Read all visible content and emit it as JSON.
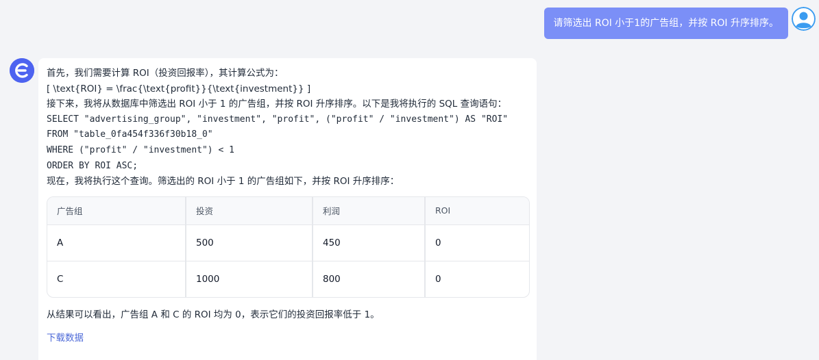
{
  "user_message": {
    "text": "请筛选出 ROI 小于1的广告组，并按 ROI 升序排序。"
  },
  "assistant": {
    "lines": [
      {
        "text": "首先，我们需要计算 ROI（投资回报率），其计算公式为：",
        "code": false
      },
      {
        "text": "[ \\text{ROI} = \\frac{\\text{profit}}{\\text{investment}} ]",
        "code": false
      },
      {
        "text": "接下来，我将从数据库中筛选出 ROI 小于 1 的广告组，并按 ROI 升序排序。以下是我将执行的 SQL 查询语句：",
        "code": false
      },
      {
        "text": "SELECT \"advertising_group\", \"investment\", \"profit\", (\"profit\" / \"investment\") AS \"ROI\"",
        "code": true
      },
      {
        "text": "FROM \"table_0fa454f336f30b18_0\"",
        "code": true
      },
      {
        "text": "WHERE (\"profit\" / \"investment\") < 1",
        "code": true
      },
      {
        "text": "ORDER BY ROI ASC;",
        "code": true
      },
      {
        "text": "现在，我将执行这个查询。筛选出的 ROI 小于 1 的广告组如下，并按 ROI 升序排序：",
        "code": false
      }
    ],
    "table": {
      "headers": [
        "广告组",
        "投资",
        "利润",
        "ROI"
      ],
      "rows": [
        [
          "A",
          "500",
          "450",
          "0"
        ],
        [
          "C",
          "1000",
          "800",
          "0"
        ]
      ]
    },
    "summary": "从结果可以看出，广告组 A 和 C 的 ROI 均为 0，表示它们的投资回报率低于 1。",
    "download_label": "下载数据"
  },
  "colors": {
    "user_bubble": "#7b8ff7",
    "bot_avatar": "#4d63f0",
    "user_avatar": "#3b9cf0",
    "link": "#4f6bd8"
  }
}
